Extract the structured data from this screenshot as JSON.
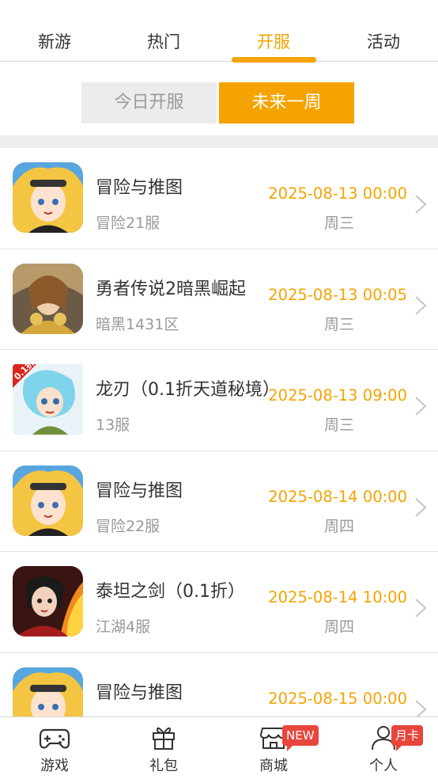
{
  "top_tabs": [
    "新游",
    "热门",
    "开服",
    "活动"
  ],
  "active_tab_index": 2,
  "segment": {
    "today": "今日开服",
    "week": "未来一周",
    "selected": "week"
  },
  "servers": [
    {
      "title": "冒险与推图",
      "server": "冒险21服",
      "time": "2025-08-13 00:00",
      "day": "周三",
      "icon": "adventure-game-icon"
    },
    {
      "title": "勇者传说2暗黑崛起",
      "server": "暗黑1431区",
      "time": "2025-08-13 00:05",
      "day": "周三",
      "icon": "hero-legend-game-icon"
    },
    {
      "title": "龙刃（0.1折天道秘境）",
      "server": "13服",
      "time": "2025-08-13 09:00",
      "day": "周三",
      "icon": "dragon-blade-game-icon",
      "corner_tag": "0.1折"
    },
    {
      "title": "冒险与推图",
      "server": "冒险22服",
      "time": "2025-08-14 00:00",
      "day": "周四",
      "icon": "adventure-game-icon"
    },
    {
      "title": "泰坦之剑（0.1折）",
      "server": "江湖4服",
      "time": "2025-08-14 10:00",
      "day": "周四",
      "icon": "titan-sword-game-icon"
    },
    {
      "title": "冒险与推图",
      "server": "",
      "time": "2025-08-15 00:00",
      "day": "",
      "icon": "adventure-game-icon"
    }
  ],
  "bottom_nav": {
    "games": "游戏",
    "gifts": "礼包",
    "mall": "商城",
    "mall_badge": "NEW",
    "profile": "个人",
    "profile_badge": "月卡"
  },
  "colors": {
    "accent": "#f5a300",
    "badge": "#e8453c",
    "muted": "#999999"
  }
}
